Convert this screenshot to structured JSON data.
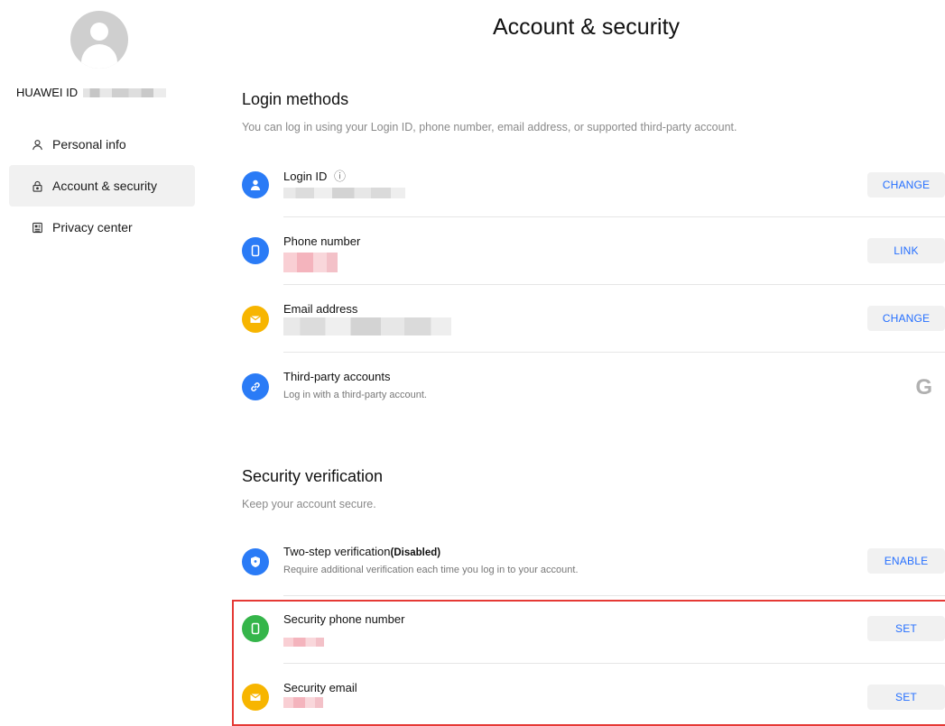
{
  "sidebar": {
    "id_label": "HUAWEI ID",
    "items": [
      {
        "label": "Personal info",
        "icon": "person-icon"
      },
      {
        "label": "Account & security",
        "icon": "lock-icon",
        "active": true
      },
      {
        "label": "Privacy center",
        "icon": "privacy-icon"
      }
    ]
  },
  "page": {
    "title": "Account & security"
  },
  "login_methods": {
    "title": "Login methods",
    "subtitle": "You can log in using your Login ID, phone number, email address, or supported third-party account.",
    "rows": [
      {
        "label": "Login ID",
        "info_icon": "ⓘ",
        "button": "CHANGE",
        "icon": "person-icon",
        "color": "#2a7bf6"
      },
      {
        "label": "Phone number",
        "button": "LINK",
        "icon": "phone-icon",
        "color": "#2a7bf6"
      },
      {
        "label": "Email address",
        "button": "CHANGE",
        "icon": "mail-icon",
        "color": "#f7b500"
      },
      {
        "label": "Third-party accounts",
        "description": "Log in with a third-party account.",
        "icon": "link-icon",
        "color": "#2a7bf6",
        "provider_glyph": "G"
      }
    ]
  },
  "security_verification": {
    "title": "Security verification",
    "subtitle": "Keep your account secure.",
    "rows": [
      {
        "label": "Two-step verification",
        "status": "(Disabled)",
        "description": "Require additional verification each time you log in to your account.",
        "button": "ENABLE",
        "icon": "shield-icon",
        "color": "#2a7bf6"
      },
      {
        "label": "Security phone number",
        "button": "SET",
        "icon": "phone-icon",
        "color": "#35b54a"
      },
      {
        "label": "Security email",
        "button": "SET",
        "icon": "mail-icon",
        "color": "#f7b500"
      }
    ]
  },
  "colors": {
    "accent": "#256fff",
    "highlight_border": "#e53935"
  }
}
